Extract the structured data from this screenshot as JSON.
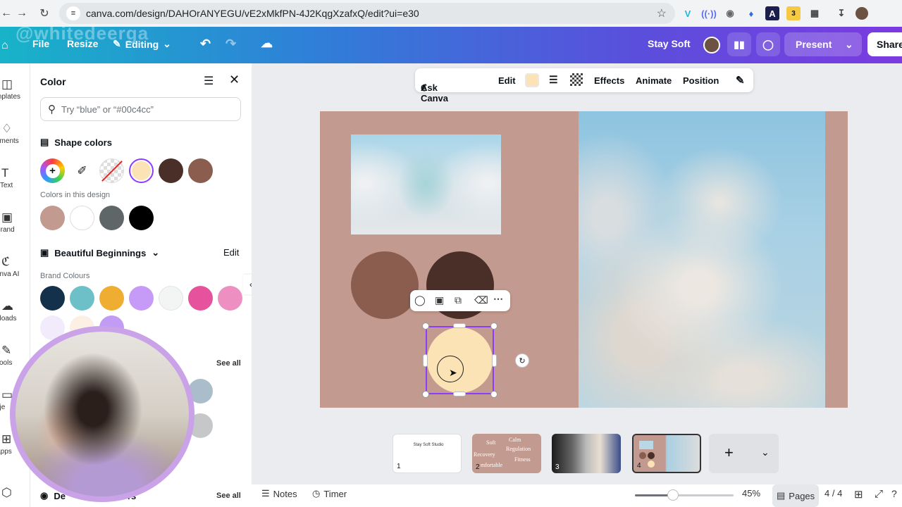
{
  "browser": {
    "url": "canva.com/design/DAHOrANYEGU/vE2xMkfPN-4J2KqgXzafxQ/edit?ui=e30"
  },
  "topbar": {
    "file": "File",
    "resize": "Resize",
    "editing": "Editing",
    "watermark": "@whitedeerga",
    "design_name": "Stay Soft",
    "present": "Present",
    "share": "Share"
  },
  "rail": {
    "items": [
      "mplates",
      "ements",
      "Text",
      "Brand",
      "anva AI",
      "ploads",
      "Tools",
      "oje",
      "Apps"
    ]
  },
  "panel": {
    "title": "Color",
    "search_placeholder": "Try “blue” or “#00c4cc”",
    "shape_colors": "Shape colors",
    "colors_in_design": "Colors in this design",
    "kit_name": "Beautiful Beginnings",
    "edit": "Edit",
    "brand_colours": "Brand Colours",
    "see_all": "See all",
    "see_all_2": "See all",
    "default_partial": "De",
    "default_partial_2": "rs"
  },
  "colors": {
    "shape": [
      "#fbe3b5",
      "#4a2f28",
      "#8a5d4f"
    ],
    "design": [
      "#c39a8f",
      "#ffffff",
      "#5f6668",
      "#000000"
    ],
    "brand": [
      "#14314c",
      "#6ec0c8",
      "#efae31",
      "#c69bf8",
      "#f3f5f5",
      "#e6529b",
      "#ee8fc2"
    ],
    "brand_row2": [
      "#f2ebfb",
      "#fcefe4",
      "#c29bf5"
    ],
    "accent": "#8b3dff"
  },
  "context_toolbar": {
    "ask_canva": "Ask Canva",
    "edit": "Edit",
    "effects": "Effects",
    "animate": "Animate",
    "position": "Position"
  },
  "pages": {
    "thumbs": [
      {
        "num": "1",
        "title": "Stay Soft Studio"
      },
      {
        "num": "2",
        "words": [
          "Soft",
          "Calm",
          "Regulation",
          "Recovery",
          "Fitness",
          "mfortable"
        ]
      },
      {
        "num": "3"
      },
      {
        "num": "4"
      }
    ]
  },
  "bottombar": {
    "notes": "Notes",
    "timer": "Timer",
    "zoom": "45%",
    "pages_label": "Pages",
    "page_count": "4 / 4",
    "zoom_level": 0.45
  }
}
